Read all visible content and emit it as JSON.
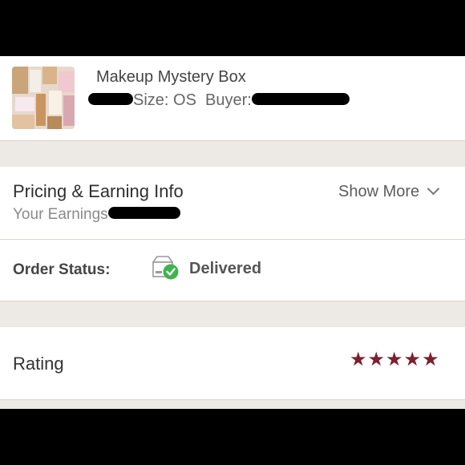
{
  "order": {
    "item_title": "Makeup Mystery Box",
    "size_label": "Size: OS",
    "buyer_label": "Buyer:"
  },
  "pricing": {
    "title": "Pricing & Earning Info",
    "earnings_label": "Your Earnings",
    "show_more_label": "Show More"
  },
  "status": {
    "label": "Order Status:",
    "value": "Delivered",
    "icon": "delivered-box-check-icon",
    "icon_check_color": "#3fb34f"
  },
  "rating": {
    "label": "Rating",
    "stars": "★★★★★",
    "value": 5,
    "max": 5,
    "star_color": "#7c2030"
  }
}
